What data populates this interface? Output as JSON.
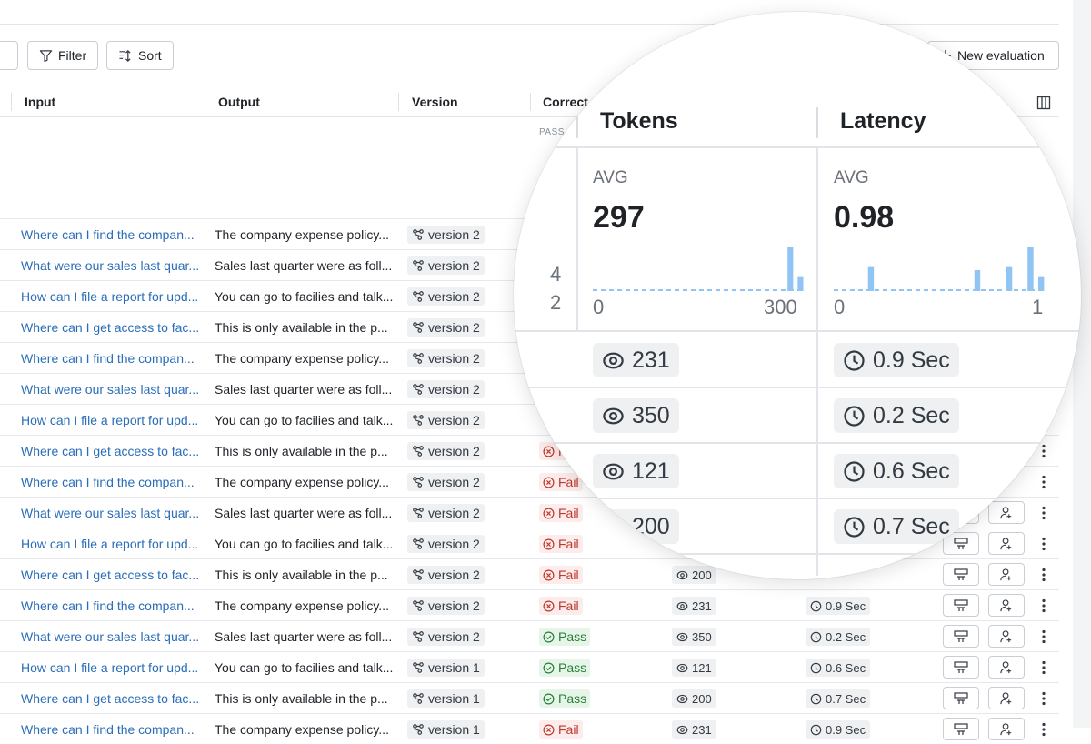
{
  "toolbar": {
    "filter_label": "Filter",
    "sort_label": "Sort",
    "new_eval_label": "New evaluation"
  },
  "columns": {
    "input": "Input",
    "output": "Output",
    "version": "Version",
    "correctness": "Correct"
  },
  "pass_mini_label": "PASS",
  "rows": [
    {
      "input": "Where can I find the compan...",
      "output": "The company expense policy...",
      "version": "version 2",
      "status": "",
      "tokens": "",
      "latency": ""
    },
    {
      "input": "What were our sales last quar...",
      "output": "Sales last quarter were as foll...",
      "version": "version 2",
      "status": "",
      "tokens": "",
      "latency": ""
    },
    {
      "input": "How can I file a report for upd...",
      "output": "You can go to facilies and talk...",
      "version": "version 2",
      "status": "",
      "tokens": "",
      "latency": ""
    },
    {
      "input": "Where can I get access to fac...",
      "output": "This is only available in the p...",
      "version": "version 2",
      "status": "",
      "tokens": "",
      "latency": ""
    },
    {
      "input": "Where can I find the compan...",
      "output": "The company expense policy...",
      "version": "version 2",
      "status": "",
      "tokens": "",
      "latency": ""
    },
    {
      "input": "What were our sales last quar...",
      "output": "Sales last quarter were as foll...",
      "version": "version 2",
      "status": "",
      "tokens": "",
      "latency": ""
    },
    {
      "input": "How can I file a report for upd...",
      "output": "You can go to facilies and talk...",
      "version": "version 2",
      "status": "",
      "tokens": "",
      "latency": ""
    },
    {
      "input": "Where can I get access to fac...",
      "output": "This is only available in the p...",
      "version": "version 2",
      "status": "Fail",
      "tokens": "",
      "latency": ""
    },
    {
      "input": "Where can I find the compan...",
      "output": "The company expense policy...",
      "version": "version 2",
      "status": "Fail",
      "tokens": "",
      "latency": ""
    },
    {
      "input": "What were our sales last quar...",
      "output": "Sales last quarter were as foll...",
      "version": "version 2",
      "status": "Fail",
      "tokens": "",
      "latency": ""
    },
    {
      "input": "How can I file a report for upd...",
      "output": "You can go to facilies and talk...",
      "version": "version 2",
      "status": "Fail",
      "tokens": "",
      "latency": ""
    },
    {
      "input": "Where can I get access to fac...",
      "output": "This is only available in the p...",
      "version": "version 2",
      "status": "Fail",
      "tokens": "200",
      "latency": ""
    },
    {
      "input": "Where can I find the compan...",
      "output": "The company expense policy...",
      "version": "version 2",
      "status": "Fail",
      "tokens": "231",
      "latency": "0.9 Sec"
    },
    {
      "input": "What were our sales last quar...",
      "output": "Sales last quarter were as foll...",
      "version": "version 2",
      "status": "Pass",
      "tokens": "350",
      "latency": "0.2 Sec"
    },
    {
      "input": "How can I file a report for upd...",
      "output": "You can go to facilies and talk...",
      "version": "version 1",
      "status": "Pass",
      "tokens": "121",
      "latency": "0.6 Sec"
    },
    {
      "input": "Where can I get access to fac...",
      "output": "This is only available in the p...",
      "version": "version 1",
      "status": "Pass",
      "tokens": "200",
      "latency": "0.7 Sec"
    },
    {
      "input": "Where can I find the compan...",
      "output": "The company expense policy...",
      "version": "version 1",
      "status": "Fail",
      "tokens": "231",
      "latency": "0.9 Sec"
    }
  ],
  "magnifier": {
    "tokens": {
      "header": "Tokens",
      "avg_label": "AVG",
      "avg_value": "297",
      "axis_min": "0",
      "axis_max": "300",
      "histogram": [
        0,
        0,
        0,
        0,
        0,
        0,
        0,
        0,
        0,
        0,
        0,
        0,
        0,
        0,
        0,
        0,
        0,
        0,
        0,
        1.0,
        0.32
      ],
      "chips": [
        "231",
        "350",
        "121",
        "200"
      ]
    },
    "latency": {
      "header": "Latency",
      "avg_label": "AVG",
      "avg_value": "0.98",
      "axis_min": "0",
      "axis_max": "1",
      "histogram": [
        0,
        0,
        0,
        0.55,
        0,
        0,
        0,
        0,
        0,
        0,
        0,
        0,
        0,
        0.48,
        0,
        0,
        0.55,
        0,
        1.0,
        0.32
      ],
      "chips": [
        "0.9 Sec",
        "0.2 Sec",
        "0.6 Sec",
        "0.7 Sec"
      ]
    },
    "correctness_counts": [
      "4",
      "2"
    ]
  },
  "colors": {
    "link": "#2a6db8",
    "pass_bg": "#e7f5e8",
    "pass_fg": "#27803a",
    "fail_bg": "#fdecec",
    "fail_fg": "#c0392b",
    "bar": "#90c4f4"
  },
  "icons": {
    "version": "git-branch-icon",
    "tokens": "eye-icon",
    "latency": "clock-icon",
    "row_action_1": "form-icon",
    "row_action_2": "person-add-icon",
    "row_menu": "kebab-icon",
    "columns": "columns-icon"
  }
}
